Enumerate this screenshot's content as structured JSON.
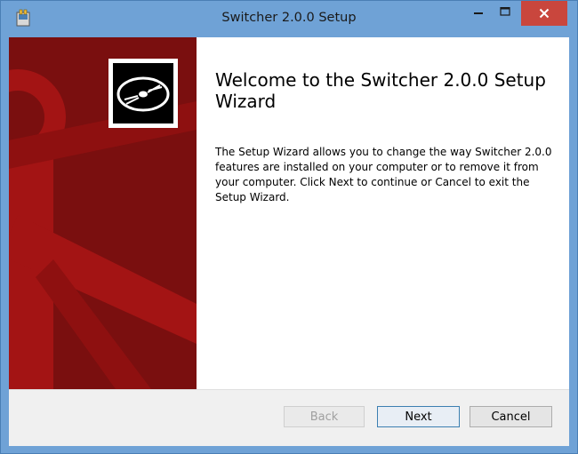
{
  "window": {
    "title": "Switcher 2.0.0 Setup",
    "icons": {
      "app": "setup-app-icon",
      "minimize": "minimize-icon",
      "maximize": "maximize-icon",
      "close": "close-icon"
    }
  },
  "banner": {
    "logo_icon": "disc-icon",
    "background_color": "#7a0f0f"
  },
  "main": {
    "heading": "Welcome to the Switcher 2.0.0 Setup Wizard",
    "description": "The Setup Wizard allows you to change the way Switcher 2.0.0 features are installed on your computer or to remove it from your computer. Click Next to continue or Cancel to exit the Setup Wizard."
  },
  "buttons": {
    "back": "Back",
    "next": "Next",
    "cancel": "Cancel"
  },
  "colors": {
    "titlebar": "#6fa2d6",
    "close_button": "#c9463d"
  }
}
